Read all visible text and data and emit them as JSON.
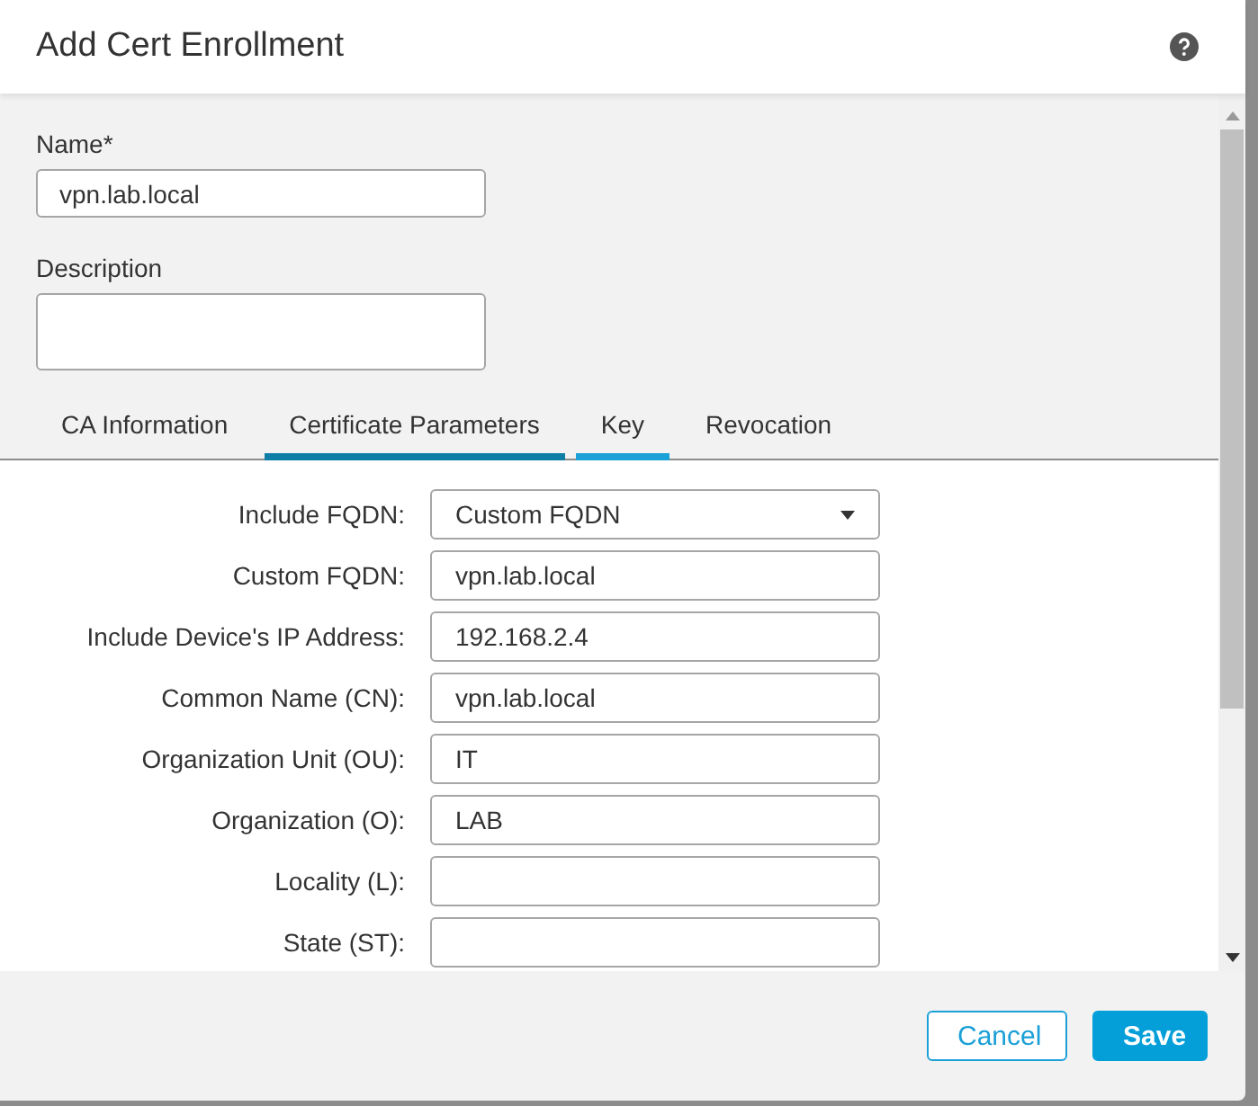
{
  "dialog": {
    "title": "Add Cert Enrollment"
  },
  "name_field": {
    "label": "Name*",
    "value": "vpn.lab.local"
  },
  "description_field": {
    "label": "Description"
  },
  "tabs": [
    {
      "label": "CA Information",
      "selected": false,
      "highlighted": false
    },
    {
      "label": "Certificate Parameters",
      "selected": true,
      "highlighted": false
    },
    {
      "label": "Key",
      "selected": false,
      "highlighted": true
    },
    {
      "label": "Revocation",
      "selected": false,
      "highlighted": false
    }
  ],
  "parameters": [
    {
      "kind": "select",
      "label": "Include FQDN:",
      "value": "Custom FQDN"
    },
    {
      "kind": "text",
      "label": "Custom FQDN:",
      "value": "vpn.lab.local"
    },
    {
      "kind": "text",
      "label": "Include Device's IP Address:",
      "value": "192.168.2.4"
    },
    {
      "kind": "text",
      "label": "Common Name (CN):",
      "value": "vpn.lab.local"
    },
    {
      "kind": "text",
      "label": "Organization Unit (OU):",
      "value": "IT"
    },
    {
      "kind": "text",
      "label": "Organization (O):",
      "value": "LAB"
    },
    {
      "kind": "text",
      "label": "Locality (L):"
    },
    {
      "kind": "text",
      "label": "State (ST):"
    }
  ],
  "buttons": [
    {
      "kind": "secondary",
      "label": "Cancel"
    },
    {
      "kind": "primary",
      "label": "Save"
    }
  ]
}
